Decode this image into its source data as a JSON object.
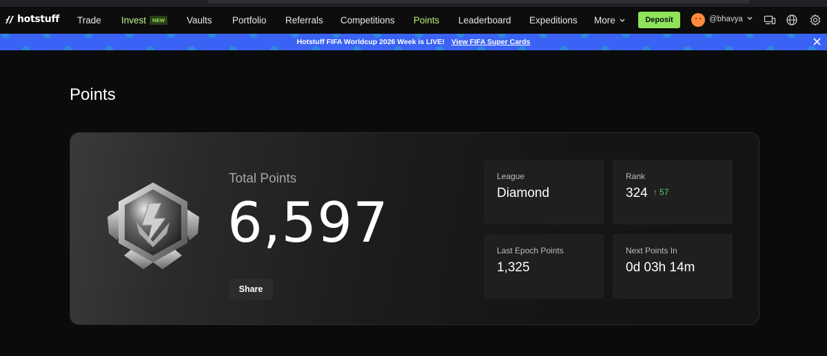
{
  "brand": {
    "name": "hotstuff"
  },
  "nav": {
    "items": [
      {
        "label": "Trade"
      },
      {
        "label": "Invest",
        "badge": "NEW"
      },
      {
        "label": "Vaults"
      },
      {
        "label": "Portfolio"
      },
      {
        "label": "Referrals"
      },
      {
        "label": "Competitions"
      },
      {
        "label": "Points",
        "active": true
      },
      {
        "label": "Leaderboard"
      },
      {
        "label": "Expeditions"
      },
      {
        "label": "More"
      }
    ],
    "deposit_label": "Deposit",
    "username": "@bhavya",
    "icons": [
      "devices-icon",
      "globe-icon",
      "gear-icon"
    ]
  },
  "banner": {
    "text": "Hotstuff FIFA Worldcup 2026 Week is LIVE!",
    "link": "View FIFA Super Cards"
  },
  "page": {
    "title": "Points"
  },
  "points": {
    "total_label": "Total Points",
    "total_value": "6,597",
    "share_label": "Share",
    "stats": {
      "league": {
        "label": "League",
        "value": "Diamond"
      },
      "rank": {
        "label": "Rank",
        "value": "324",
        "delta": "↑ 57"
      },
      "last_epoch": {
        "label": "Last Epoch Points",
        "value": "1,325"
      },
      "next_points": {
        "label": "Next Points In",
        "value": "0d 03h 14m"
      }
    }
  },
  "colors": {
    "accent_green": "#8ee35b",
    "banner_blue": "#3a63f5",
    "rank_up": "#5ed27b"
  }
}
